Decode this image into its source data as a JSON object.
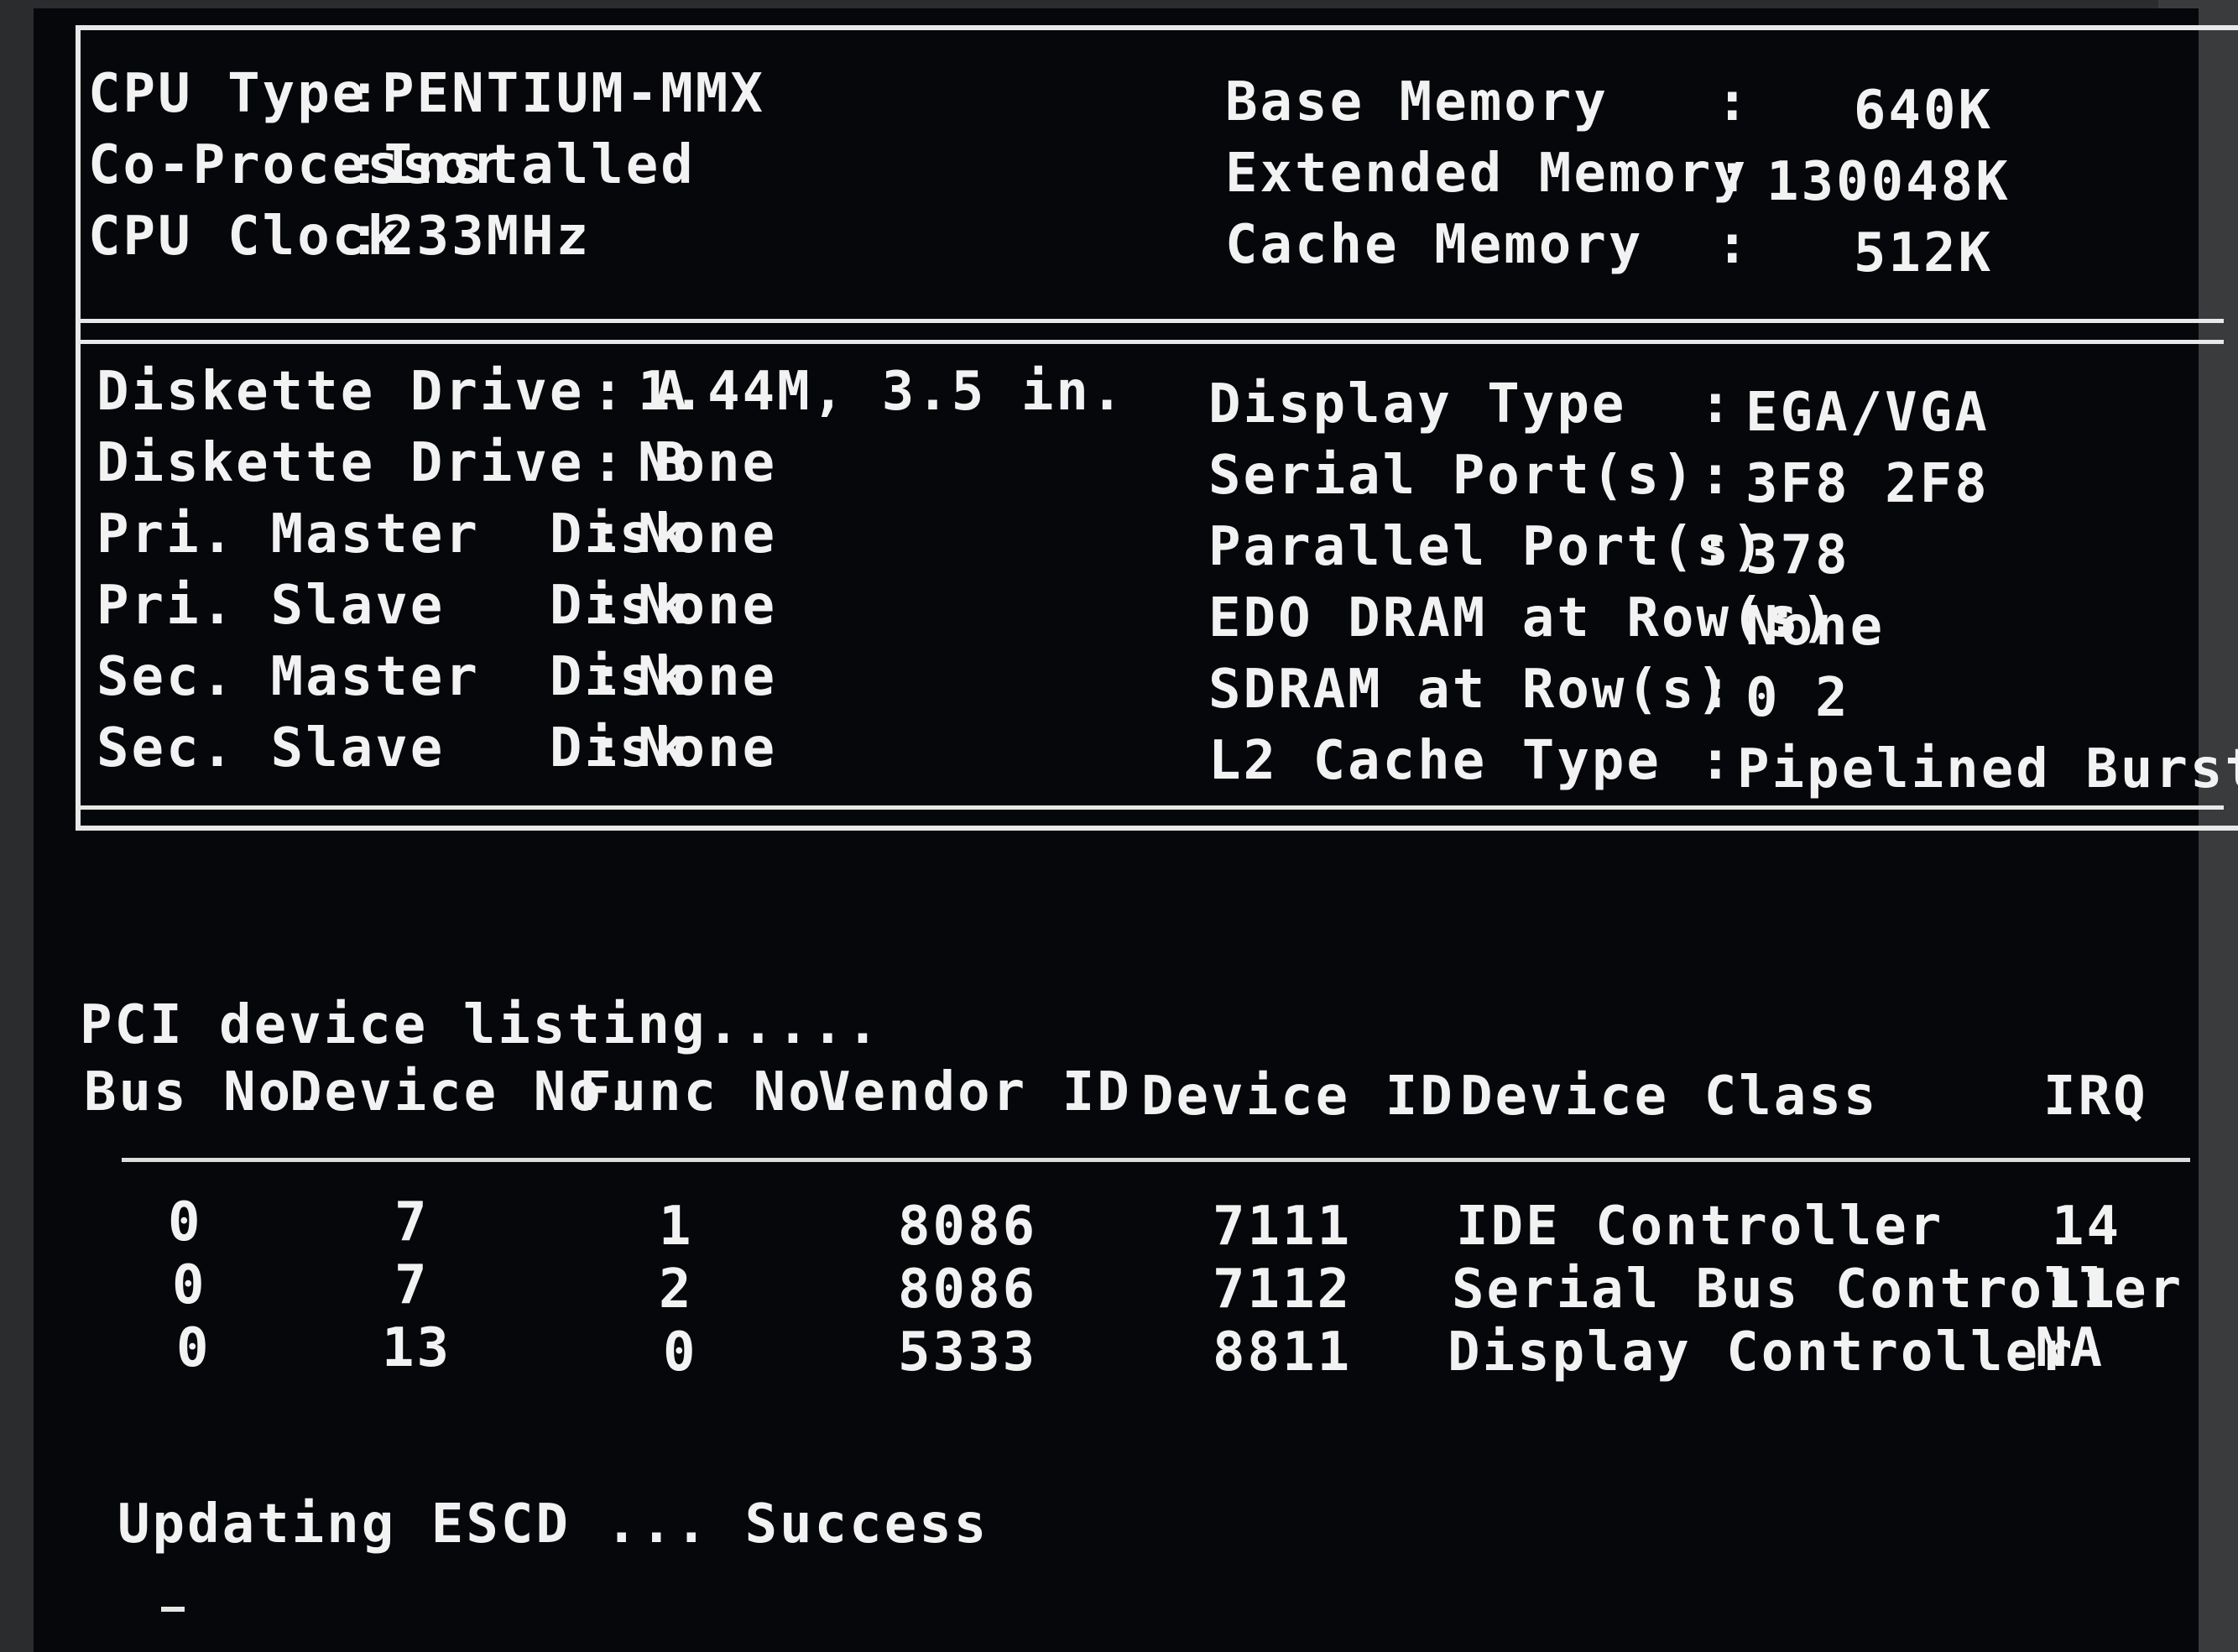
{
  "system_info": {
    "left_rows": [
      {
        "label": "CPU Type",
        "value": "PENTIUM-MMX"
      },
      {
        "label": "Co-Processor",
        "value": "Installed"
      },
      {
        "label": "CPU Clock",
        "value": "233MHz"
      }
    ],
    "right_rows": [
      {
        "label": "Base Memory",
        "value": "640K"
      },
      {
        "label": "Extended Memory",
        "value": "130048K"
      },
      {
        "label": "Cache Memory",
        "value": "512K"
      }
    ]
  },
  "devices": {
    "left_rows": [
      {
        "label": "Diskette Drive  A",
        "value": "1.44M, 3.5 in."
      },
      {
        "label": "Diskette Drive  B",
        "value": "None"
      },
      {
        "label": "Pri. Master  Disk",
        "value": "None"
      },
      {
        "label": "Pri. Slave   Disk",
        "value": "None"
      },
      {
        "label": "Sec. Master  Disk",
        "value": "None"
      },
      {
        "label": "Sec. Slave   Disk",
        "value": "None"
      }
    ],
    "right_rows": [
      {
        "label": "Display Type",
        "value": "EGA/VGA"
      },
      {
        "label": "Serial Port(s)",
        "value": "3F8 2F8"
      },
      {
        "label": "Parallel Port(s)",
        "value": "378"
      },
      {
        "label": "EDO DRAM at Row(s)",
        "value": "None"
      },
      {
        "label": "SDRAM at Row(s)",
        "value": "0 2"
      },
      {
        "label": "L2 Cache Type",
        "value": "Pipelined Burst"
      }
    ]
  },
  "pci": {
    "heading": "PCI device listing.....",
    "columns": [
      "Bus No.",
      "Device No.",
      "Func No.",
      "Vendor ID",
      "Device ID",
      "Device Class",
      "IRQ"
    ],
    "rows": [
      [
        "0",
        "7",
        "1",
        "8086",
        "7111",
        "IDE Controller",
        "14"
      ],
      [
        "0",
        "7",
        "2",
        "8086",
        "7112",
        "Serial Bus Controller",
        "11"
      ],
      [
        "0",
        "13",
        "0",
        "5333",
        "8811",
        "Display Controller",
        "NA"
      ]
    ]
  },
  "status": {
    "message": "Updating ESCD ... Success"
  },
  "colors": {
    "screen_bg": "#06070b",
    "text": "#f2f2f2",
    "border": "#e8e8e8"
  }
}
